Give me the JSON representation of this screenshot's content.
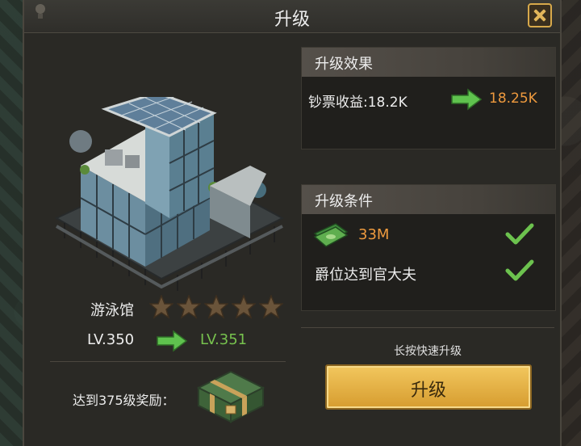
{
  "dialog": {
    "title": "升级"
  },
  "building": {
    "name": "游泳馆",
    "stars": 5,
    "level_current": "LV.350",
    "level_next": "LV.351",
    "reward_label": "达到375级奖励："
  },
  "effect": {
    "header": "升级效果",
    "label": "钞票收益:18.2K",
    "next_value": "18.25K"
  },
  "conditions": {
    "header": "升级条件",
    "cost": "33M",
    "rank_requirement": "爵位达到官大夫"
  },
  "action": {
    "hint": "长按快速升级",
    "upgrade_label": "升级"
  },
  "colors": {
    "accent_gold": "#e2b65a",
    "next_level_green": "#77c24e",
    "value_orange": "#ee9a3e"
  }
}
